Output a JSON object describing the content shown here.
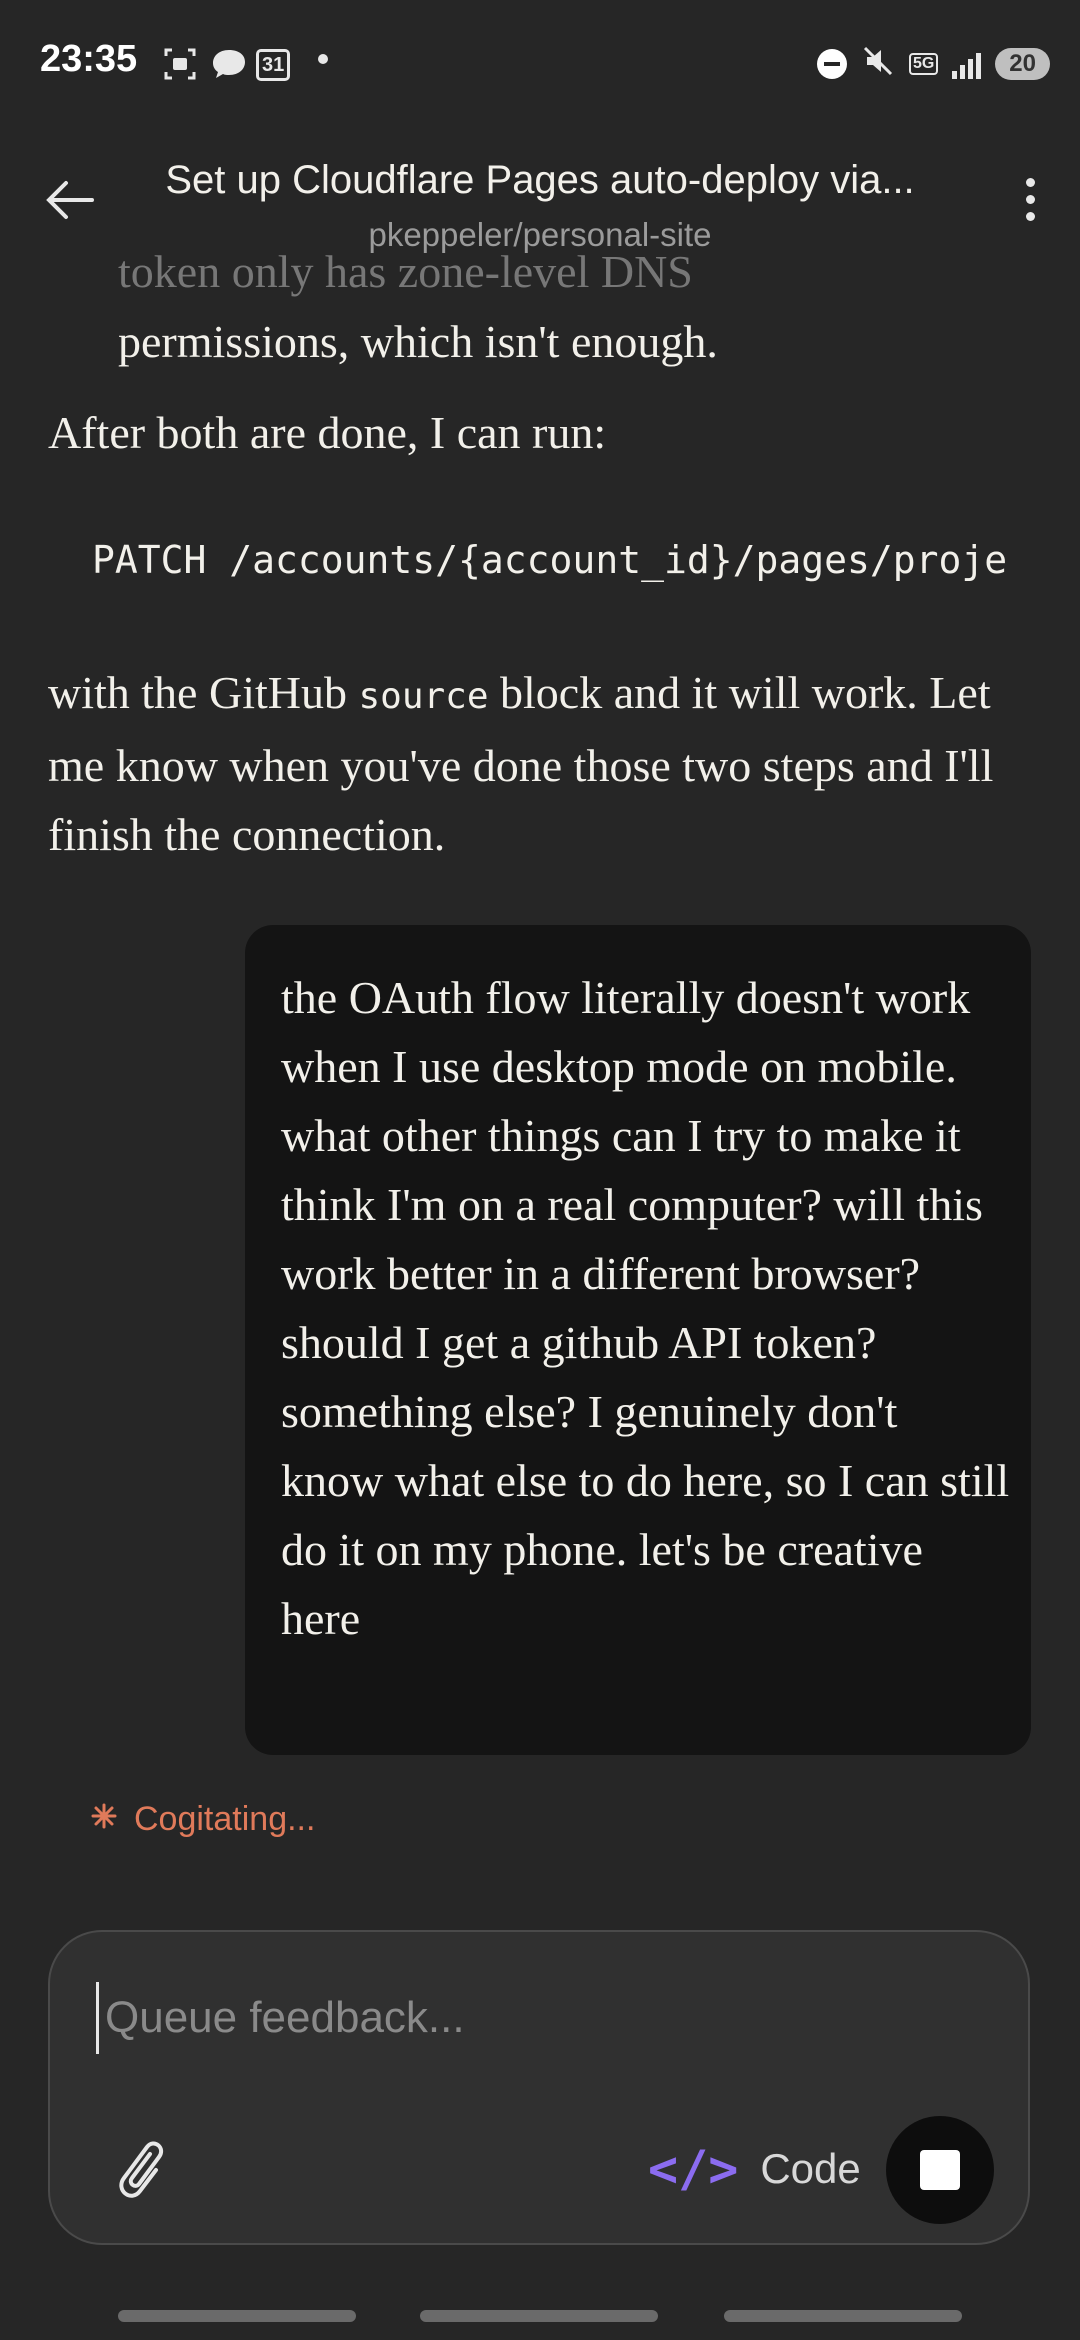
{
  "status_bar": {
    "time": "23:35",
    "calendar_day": "31",
    "network": "5G",
    "battery": "20"
  },
  "header": {
    "title": "Set up Cloudflare Pages auto-deploy via...",
    "subtitle": "pkeppeler/personal-site"
  },
  "conversation": {
    "faded_line": "token only has zone-level DNS",
    "permissions_line": "permissions, which isn't enough.",
    "after_line": "After both are done, I can run:",
    "code_line": "PATCH /accounts/{account_id}/pages/proje",
    "p2_before": "with the GitHub ",
    "p2_code": "source",
    "p2_after": " block and it will work. Let me know when you've done those two steps and I'll finish the connection.",
    "user_message": "the OAuth flow literally doesn't work when I use desktop mode on mobile. what other things can I try to make it think I'm on a real computer? will this work better in a different browser? should I get a github API token? something else? I genuinely don't know what else to do here, so I can still do it on my phone. let's be creative here"
  },
  "status_text": "Cogitating...",
  "composer": {
    "placeholder": "Queue feedback...",
    "code_label": "Code"
  },
  "colors": {
    "background": "#262626",
    "accent_orange": "#e07a5a",
    "accent_purple": "#8b6cf0",
    "user_bubble": "#141414"
  }
}
